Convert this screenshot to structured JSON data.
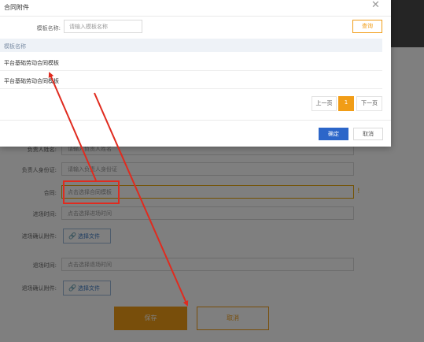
{
  "form": {
    "rows": [
      {
        "label": "负责人姓名:",
        "placeholder": "请输入负责人姓名"
      },
      {
        "label": "负责人身份证:",
        "placeholder": "请输入负责人身份证"
      },
      {
        "label": "合同:",
        "placeholder": "点击选择合同模板"
      },
      {
        "label": "进场时间:",
        "placeholder": "点击选择进场时间"
      },
      {
        "label": "进场确认附件:"
      },
      {
        "label": "退场时间:",
        "placeholder": "点击选择退场时间"
      },
      {
        "label": "退场确认附件:"
      }
    ],
    "upload_label": "选择文件",
    "save_label": "保存",
    "cancel_label": "取消"
  },
  "dialog": {
    "title": "合同附件",
    "search_label": "模板名称:",
    "search_placeholder": "请输入模板名称",
    "query_label": "查询",
    "table_header": "模板名称",
    "rows": [
      "平台基础劳动合同模板",
      "平台基础劳动合同模板"
    ],
    "pager": {
      "prev": "上一页",
      "page": "1",
      "next": "下一页"
    },
    "confirm_label": "确定",
    "close_label": "取消"
  },
  "colors": {
    "accent": "#f19d17",
    "primary": "#2c66c9",
    "annotation": "#e02b1f"
  },
  "icons": {
    "close": "close-icon",
    "upload": "link-icon"
  }
}
